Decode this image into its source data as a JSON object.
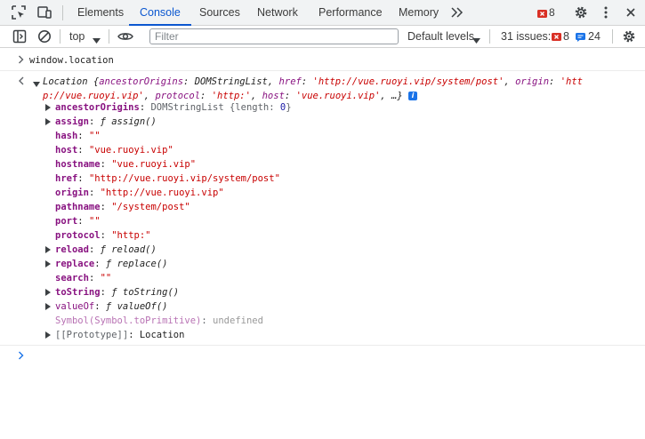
{
  "tabs": [
    {
      "label": "Elements"
    },
    {
      "label": "Console",
      "active": true
    },
    {
      "label": "Sources"
    },
    {
      "label": "Network"
    },
    {
      "label": "Performance"
    },
    {
      "label": "Memory"
    }
  ],
  "tabbar": {
    "errors_count": "8",
    "more_icon": "chevron-double-right-icon"
  },
  "toolbar": {
    "context_value": "top",
    "filter_placeholder": "Filter",
    "levels_label": "Default levels",
    "issues_label": "31 issues:",
    "issues_errors": "8",
    "issues_info": "24"
  },
  "console": {
    "input": "window.location",
    "summary_prefix": "Location {",
    "summary_k1": "ancestorOrigins",
    "summary_v1": "DOMStringList",
    "summary_k2": "href",
    "summary_v2": "'http://vue.ruoyi.vip/system/post'",
    "summary_k3": "origin",
    "summary_v3a": "'htt",
    "summary_v3b": "p://vue.ruoyi.vip'",
    "summary_k4": "protocol",
    "summary_v4": "'http:'",
    "summary_k5": "host",
    "summary_v5": "'vue.ruoyi.vip'",
    "summary_end": "…}",
    "info_badge": "i",
    "props": [
      {
        "key": "ancestorOrigins",
        "sep": ": ",
        "val": "DOMStringList {length: ",
        "num": "0",
        "tail": "}"
      },
      {
        "key": "assign",
        "sep": ": ",
        "val": "ƒ assign()"
      },
      {
        "key": "hash",
        "sep": ": ",
        "val": "\"\""
      },
      {
        "key": "host",
        "sep": ": ",
        "val": "\"vue.ruoyi.vip\""
      },
      {
        "key": "hostname",
        "sep": ": ",
        "val": "\"vue.ruoyi.vip\""
      },
      {
        "key": "href",
        "sep": ": ",
        "val": "\"http://vue.ruoyi.vip/system/post\""
      },
      {
        "key": "origin",
        "sep": ": ",
        "val": "\"http://vue.ruoyi.vip\""
      },
      {
        "key": "pathname",
        "sep": ": ",
        "val": "\"/system/post\""
      },
      {
        "key": "port",
        "sep": ": ",
        "val": "\"\""
      },
      {
        "key": "protocol",
        "sep": ": ",
        "val": "\"http:\""
      },
      {
        "key": "reload",
        "sep": ": ",
        "val": "ƒ reload()"
      },
      {
        "key": "replace",
        "sep": ": ",
        "val": "ƒ replace()"
      },
      {
        "key": "search",
        "sep": ": ",
        "val": "\"\""
      },
      {
        "key": "toString",
        "sep": ": ",
        "val": "ƒ toString()"
      },
      {
        "key": "valueOf",
        "sep": ": ",
        "val": "ƒ valueOf()"
      },
      {
        "key": "Symbol(Symbol.toPrimitive)",
        "sep": ": ",
        "val": "undefined"
      },
      {
        "key": "[[Prototype]]",
        "sep": ": ",
        "val": "Location"
      }
    ]
  },
  "colors": {
    "accent": "#0b57d0",
    "error": "#d93025",
    "info": "#1a73e8",
    "string": "#c80000",
    "key": "#881280"
  }
}
